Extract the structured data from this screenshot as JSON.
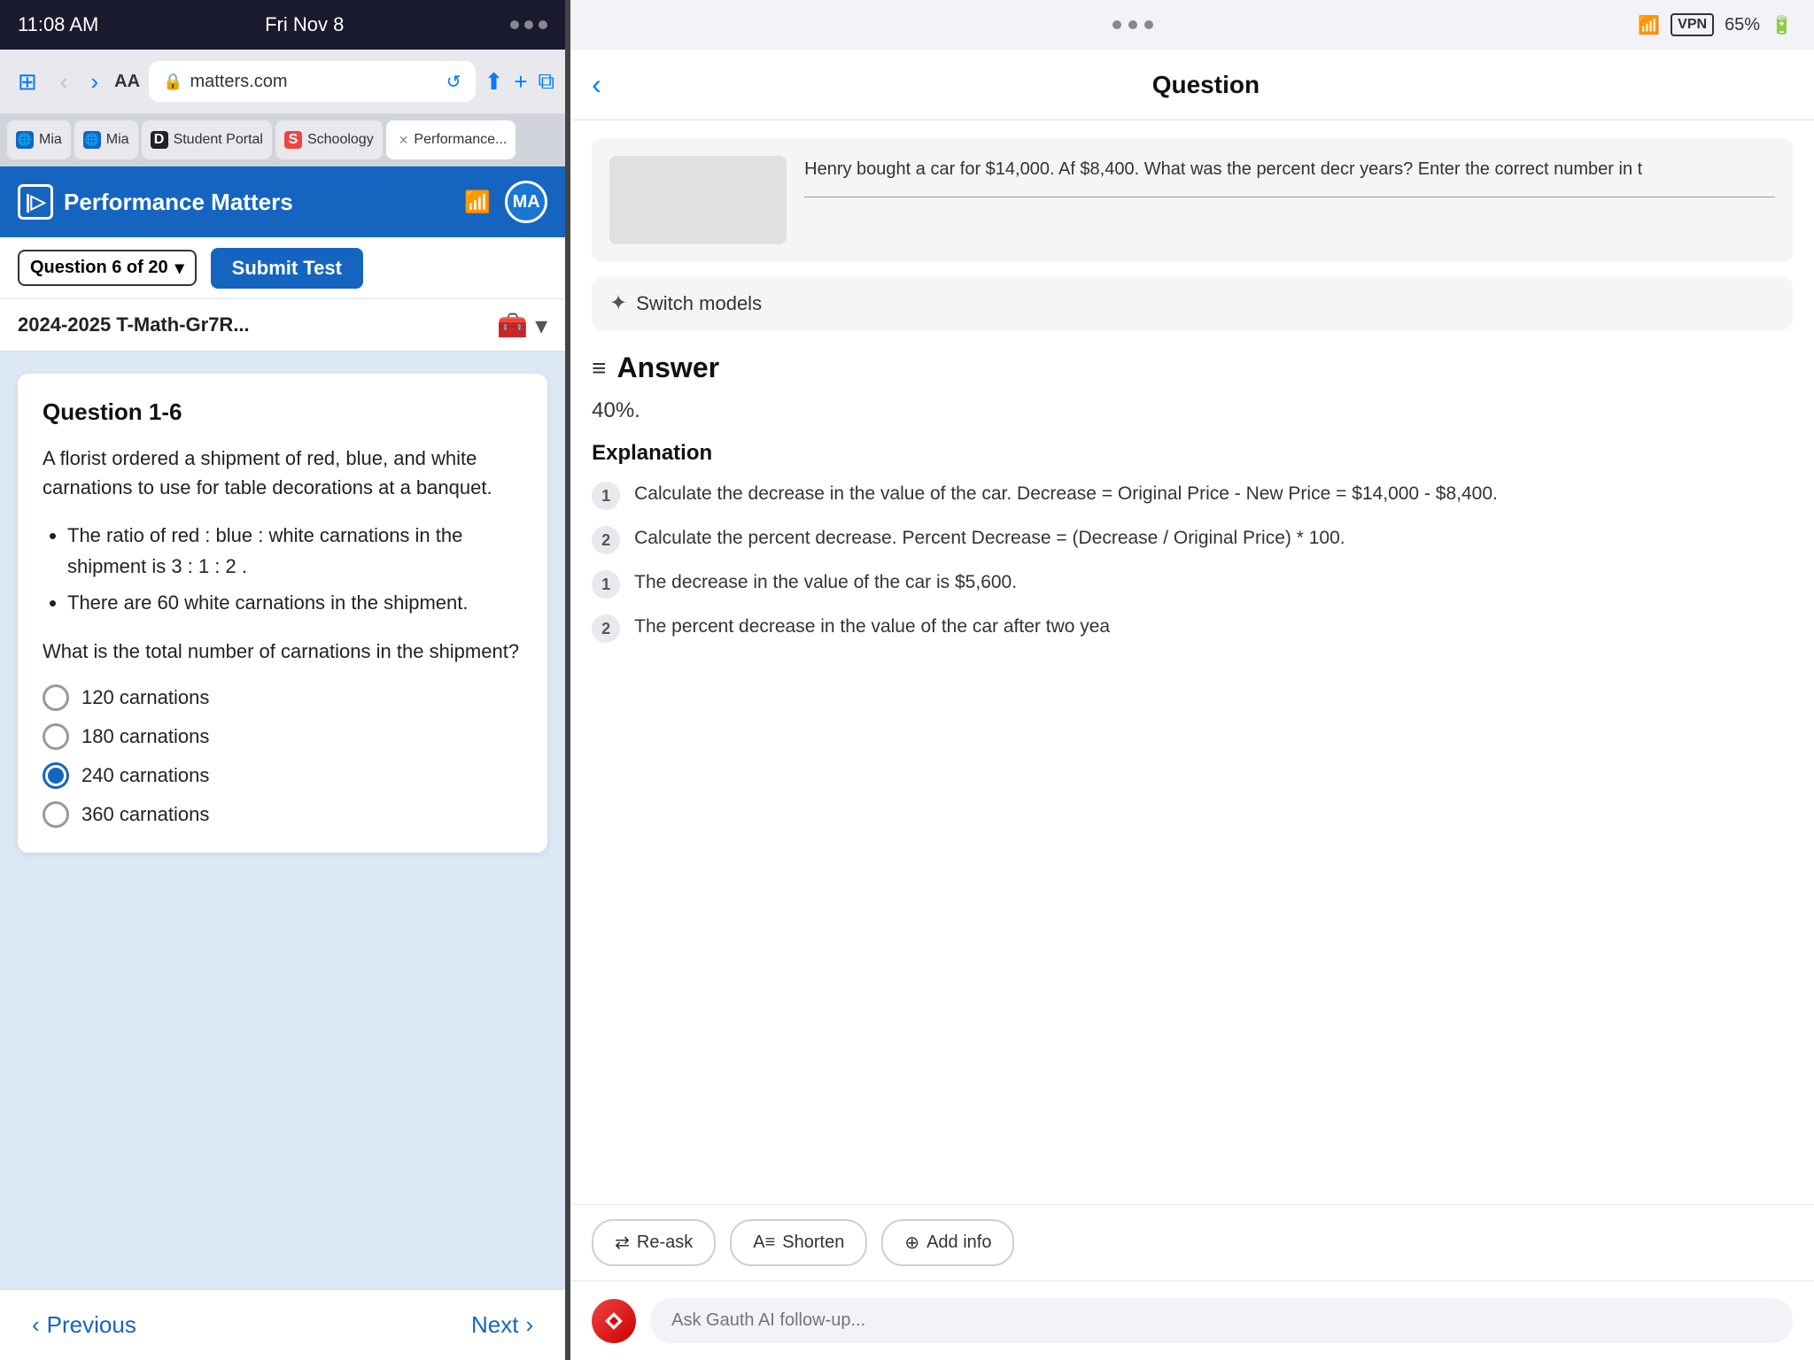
{
  "left": {
    "status_bar": {
      "time": "11:08 AM",
      "date": "Fri Nov 8",
      "dots": 3
    },
    "browser": {
      "url": "matters.com",
      "reload_icon": "↺",
      "back": "‹",
      "forward": "›",
      "aa": "AA"
    },
    "tabs": [
      {
        "label": "Mia",
        "icon": "🌐",
        "active": false
      },
      {
        "label": "Mia",
        "icon": "🌐",
        "active": false
      },
      {
        "label": "Student Portal",
        "icon": "D",
        "active": false
      },
      {
        "label": "Schoology",
        "icon": "S",
        "active": false
      },
      {
        "label": "Performance...",
        "icon": "×",
        "active": true
      }
    ],
    "header": {
      "logo_symbol": "|▷",
      "title": "Performance Matters",
      "avatar": "MA"
    },
    "question_nav": {
      "question_label": "Question 6 of 20",
      "submit_label": "Submit Test",
      "dropdown_arrow": "▾"
    },
    "test_title": "2024-2025 T-Math-Gr7R...",
    "question": {
      "number": "Question 1-6",
      "intro": "A florist ordered a shipment of red, blue, and white carnations to use for table decorations at a banquet.",
      "bullets": [
        "The ratio of red : blue : white carnations in the shipment is 3 : 1 : 2 .",
        "There are 60 white carnations in the shipment."
      ],
      "prompt": "What is the total number of carnations in the shipment?",
      "options": [
        {
          "label": "120 carnations",
          "selected": false
        },
        {
          "label": "180 carnations",
          "selected": false
        },
        {
          "label": "240 carnations",
          "selected": true
        },
        {
          "label": "360 carnations",
          "selected": false
        }
      ]
    },
    "nav": {
      "previous": "Previous",
      "next": "Next"
    }
  },
  "right": {
    "status_bar": {
      "wifi": "WiFi",
      "vpn": "VPN",
      "battery": "65%"
    },
    "header": {
      "back": "‹",
      "title": "Question"
    },
    "question_image_text": "Henry bought a car for $14,000. Af $8,400. What was the percent decr years? Enter the correct number in t",
    "switch_models": {
      "icon": "✦",
      "label": "Switch models"
    },
    "answer": {
      "icon": "≡",
      "title": "Answer",
      "value": "40%.",
      "explanation_title": "Explanation",
      "steps": [
        {
          "num": "1",
          "text": "Calculate the decrease in the value of the car. Decrease = Original Price - New Price = $14,000 - $8,400."
        },
        {
          "num": "2",
          "text": "Calculate the percent decrease. Percent Decrease = (Decrease / Original Price) * 100."
        },
        {
          "num": "1",
          "text": "The decrease in the value of the car is $5,600."
        },
        {
          "num": "2",
          "text": "The percent decrease in the value of the car after two yea"
        }
      ]
    },
    "action_buttons": [
      {
        "icon": "⇄",
        "label": "Re-ask"
      },
      {
        "icon": "A≡",
        "label": "Shorten"
      },
      {
        "icon": "⊕",
        "label": "Add info"
      }
    ],
    "chat": {
      "placeholder": "Ask Gauth AI follow-up...",
      "logo": "✕"
    }
  }
}
